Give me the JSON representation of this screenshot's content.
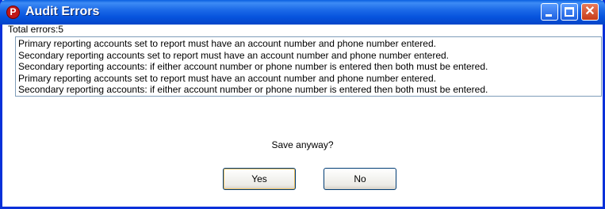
{
  "window": {
    "title": "Audit Errors",
    "app_icon_letter": "P"
  },
  "titlebar_buttons": {
    "minimize_icon": "minimize-icon",
    "maximize_icon": "maximize-icon",
    "close_icon": "close-icon",
    "close_glyph": "✕"
  },
  "summary": {
    "total_errors": "Total errors:5"
  },
  "errors": [
    "Primary reporting accounts set to report must have an account number and phone number entered.",
    "Secondary reporting accounts set to report must have an account number and phone number entered.",
    "Secondary reporting accounts: if either account number or phone number is entered then both must be entered.",
    "Primary reporting accounts set to report must have an account number and phone number entered.",
    "Secondary reporting accounts: if either account number or phone number is entered then both must be entered."
  ],
  "prompt": "Save anyway?",
  "buttons": {
    "yes": "Yes",
    "no": "No"
  },
  "colors": {
    "titlebar": "#0653dd",
    "close_button": "#c63b18",
    "list_border": "#7f9db9"
  }
}
